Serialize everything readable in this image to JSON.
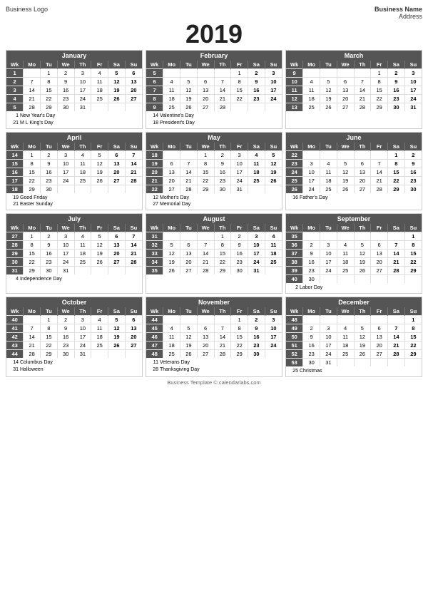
{
  "header": {
    "logo": "Business Logo",
    "name": "Business Name",
    "address": "Address"
  },
  "year": "2019",
  "footer": "Business Template © calendarlabs.com",
  "months": [
    {
      "name": "January",
      "weeks": [
        [
          "1",
          "",
          "1",
          "2",
          "3",
          "4",
          "5",
          "6"
        ],
        [
          "2",
          "7",
          "8",
          "9",
          "10",
          "11",
          "12",
          "13"
        ],
        [
          "3",
          "14",
          "15",
          "16",
          "17",
          "18",
          "19",
          "20"
        ],
        [
          "4",
          "21",
          "22",
          "23",
          "24",
          "25",
          "26",
          "27"
        ],
        [
          "5",
          "28",
          "29",
          "30",
          "31",
          "",
          "",
          ""
        ]
      ],
      "holidays": [
        {
          "num": "1",
          "name": "New Year's Day"
        },
        {
          "num": "21",
          "name": "M L King's Day"
        }
      ]
    },
    {
      "name": "February",
      "weeks": [
        [
          "5",
          "",
          "",
          "",
          "",
          "1",
          "2",
          "3"
        ],
        [
          "6",
          "4",
          "5",
          "6",
          "7",
          "8",
          "9",
          "10"
        ],
        [
          "7",
          "11",
          "12",
          "13",
          "14",
          "15",
          "16",
          "17"
        ],
        [
          "8",
          "18",
          "19",
          "20",
          "21",
          "22",
          "23",
          "24"
        ],
        [
          "9",
          "25",
          "26",
          "27",
          "28",
          "",
          "",
          ""
        ]
      ],
      "holidays": [
        {
          "num": "14",
          "name": "Valentine's Day"
        },
        {
          "num": "18",
          "name": "President's Day"
        }
      ]
    },
    {
      "name": "March",
      "weeks": [
        [
          "9",
          "",
          "",
          "",
          "",
          "1",
          "2",
          "3"
        ],
        [
          "10",
          "4",
          "5",
          "6",
          "7",
          "8",
          "9",
          "10"
        ],
        [
          "11",
          "11",
          "12",
          "13",
          "14",
          "15",
          "16",
          "17"
        ],
        [
          "12",
          "18",
          "19",
          "20",
          "21",
          "22",
          "23",
          "24"
        ],
        [
          "13",
          "25",
          "26",
          "27",
          "28",
          "29",
          "30",
          "31"
        ]
      ],
      "holidays": []
    },
    {
      "name": "April",
      "weeks": [
        [
          "14",
          "1",
          "2",
          "3",
          "4",
          "5",
          "6",
          "7"
        ],
        [
          "15",
          "8",
          "9",
          "10",
          "11",
          "12",
          "13",
          "14"
        ],
        [
          "16",
          "15",
          "16",
          "17",
          "18",
          "19",
          "20",
          "21"
        ],
        [
          "17",
          "22",
          "23",
          "24",
          "25",
          "26",
          "27",
          "28"
        ],
        [
          "18",
          "29",
          "30",
          "",
          "",
          "",
          "",
          ""
        ]
      ],
      "holidays": [
        {
          "num": "19",
          "name": "Good Friday"
        },
        {
          "num": "21",
          "name": "Easter Sunday"
        }
      ]
    },
    {
      "name": "May",
      "weeks": [
        [
          "18",
          "",
          "",
          "1",
          "2",
          "3",
          "4",
          "5"
        ],
        [
          "19",
          "6",
          "7",
          "8",
          "9",
          "10",
          "11",
          "12"
        ],
        [
          "20",
          "13",
          "14",
          "15",
          "16",
          "17",
          "18",
          "19"
        ],
        [
          "21",
          "20",
          "21",
          "22",
          "23",
          "24",
          "25",
          "26"
        ],
        [
          "22",
          "27",
          "28",
          "29",
          "30",
          "31",
          "",
          ""
        ]
      ],
      "holidays": [
        {
          "num": "12",
          "name": "Mother's Day"
        },
        {
          "num": "27",
          "name": "Memorial Day"
        }
      ]
    },
    {
      "name": "June",
      "weeks": [
        [
          "22",
          "",
          "",
          "",
          "",
          "",
          "1",
          "2"
        ],
        [
          "23",
          "3",
          "4",
          "5",
          "6",
          "7",
          "8",
          "9"
        ],
        [
          "24",
          "10",
          "11",
          "12",
          "13",
          "14",
          "15",
          "16"
        ],
        [
          "25",
          "17",
          "18",
          "19",
          "20",
          "21",
          "22",
          "23"
        ],
        [
          "26",
          "24",
          "25",
          "26",
          "27",
          "28",
          "29",
          "30"
        ]
      ],
      "holidays": [
        {
          "num": "16",
          "name": "Father's Day"
        }
      ]
    },
    {
      "name": "July",
      "weeks": [
        [
          "27",
          "1",
          "2",
          "3",
          "4",
          "5",
          "6",
          "7"
        ],
        [
          "28",
          "8",
          "9",
          "10",
          "11",
          "12",
          "13",
          "14"
        ],
        [
          "29",
          "15",
          "16",
          "17",
          "18",
          "19",
          "20",
          "21"
        ],
        [
          "30",
          "22",
          "23",
          "24",
          "25",
          "26",
          "27",
          "28"
        ],
        [
          "31",
          "29",
          "30",
          "31",
          "",
          "",
          "",
          ""
        ]
      ],
      "holidays": [
        {
          "num": "4",
          "name": "Independence Day"
        }
      ]
    },
    {
      "name": "August",
      "weeks": [
        [
          "31",
          "",
          "",
          "",
          "1",
          "2",
          "3",
          "4"
        ],
        [
          "32",
          "5",
          "6",
          "7",
          "8",
          "9",
          "10",
          "11"
        ],
        [
          "33",
          "12",
          "13",
          "14",
          "15",
          "16",
          "17",
          "18"
        ],
        [
          "34",
          "19",
          "20",
          "21",
          "22",
          "23",
          "24",
          "25"
        ],
        [
          "35",
          "26",
          "27",
          "28",
          "29",
          "30",
          "31",
          ""
        ]
      ],
      "holidays": []
    },
    {
      "name": "September",
      "weeks": [
        [
          "35",
          "",
          "",
          "",
          "",
          "",
          "",
          "1"
        ],
        [
          "36",
          "2",
          "3",
          "4",
          "5",
          "6",
          "7",
          "8"
        ],
        [
          "37",
          "9",
          "10",
          "11",
          "12",
          "13",
          "14",
          "15"
        ],
        [
          "38",
          "16",
          "17",
          "18",
          "19",
          "20",
          "21",
          "22"
        ],
        [
          "39",
          "23",
          "24",
          "25",
          "26",
          "27",
          "28",
          "29"
        ],
        [
          "40",
          "30",
          "",
          "",
          "",
          "",
          "",
          ""
        ]
      ],
      "holidays": [
        {
          "num": "2",
          "name": "Labor Day"
        }
      ]
    },
    {
      "name": "October",
      "weeks": [
        [
          "40",
          "",
          "1",
          "2",
          "3",
          "4",
          "5",
          "6"
        ],
        [
          "41",
          "7",
          "8",
          "9",
          "10",
          "11",
          "12",
          "13"
        ],
        [
          "42",
          "14",
          "15",
          "16",
          "17",
          "18",
          "19",
          "20"
        ],
        [
          "43",
          "21",
          "22",
          "23",
          "24",
          "25",
          "26",
          "27"
        ],
        [
          "44",
          "28",
          "29",
          "30",
          "31",
          "",
          "",
          ""
        ]
      ],
      "holidays": [
        {
          "num": "14",
          "name": "Columbus Day"
        },
        {
          "num": "31",
          "name": "Halloween"
        }
      ]
    },
    {
      "name": "November",
      "weeks": [
        [
          "44",
          "",
          "",
          "",
          "",
          "1",
          "2",
          "3"
        ],
        [
          "45",
          "4",
          "5",
          "6",
          "7",
          "8",
          "9",
          "10"
        ],
        [
          "46",
          "11",
          "12",
          "13",
          "14",
          "15",
          "16",
          "17"
        ],
        [
          "47",
          "18",
          "19",
          "20",
          "21",
          "22",
          "23",
          "24"
        ],
        [
          "48",
          "25",
          "26",
          "27",
          "28",
          "29",
          "30",
          ""
        ]
      ],
      "holidays": [
        {
          "num": "11",
          "name": "Veterans Day"
        },
        {
          "num": "28",
          "name": "Thanksgiving Day"
        }
      ]
    },
    {
      "name": "December",
      "weeks": [
        [
          "48",
          "",
          "",
          "",
          "",
          "",
          "",
          "1"
        ],
        [
          "49",
          "2",
          "3",
          "4",
          "5",
          "6",
          "7",
          "8"
        ],
        [
          "50",
          "9",
          "10",
          "11",
          "12",
          "13",
          "14",
          "15"
        ],
        [
          "51",
          "16",
          "17",
          "18",
          "19",
          "20",
          "21",
          "22"
        ],
        [
          "52",
          "23",
          "24",
          "25",
          "26",
          "27",
          "28",
          "29"
        ],
        [
          "53",
          "30",
          "31",
          "",
          "",
          "",
          "",
          ""
        ]
      ],
      "holidays": [
        {
          "num": "25",
          "name": "Christmas"
        }
      ]
    }
  ],
  "col_headers": [
    "Wk",
    "Mo",
    "Tu",
    "We",
    "Th",
    "Fr",
    "Sa",
    "Su"
  ]
}
